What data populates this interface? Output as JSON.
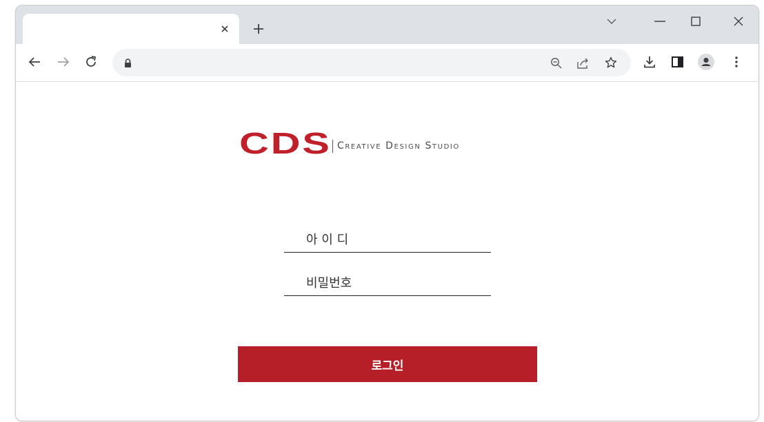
{
  "browser": {
    "tab": {
      "title": "",
      "close_symbol": "×"
    },
    "new_tab_symbol": "+",
    "address_bar": {
      "url": ""
    },
    "icons": {
      "back": "arrow-left-icon",
      "forward": "arrow-right-icon",
      "reload": "reload-icon",
      "lock": "lock-icon",
      "zoom": "zoom-out-icon",
      "share": "share-icon",
      "bookmark": "star-icon",
      "download": "download-icon",
      "side_panel": "side-panel-icon",
      "profile": "profile-icon",
      "menu": "kebab-menu-icon",
      "tab_search": "chevron-down-icon",
      "minimize": "minimize-icon",
      "maximize": "maximize-icon",
      "close": "close-icon"
    }
  },
  "page": {
    "logo": {
      "mark": "CDS",
      "subtitle": "Creative Design Studio"
    },
    "form": {
      "username_placeholder": "아 이 디",
      "password_placeholder": "비밀번호",
      "login_label": "로그인"
    }
  },
  "colors": {
    "brand": "#c0202a",
    "button": "#b71f28",
    "chrome": "#dee1e6"
  }
}
